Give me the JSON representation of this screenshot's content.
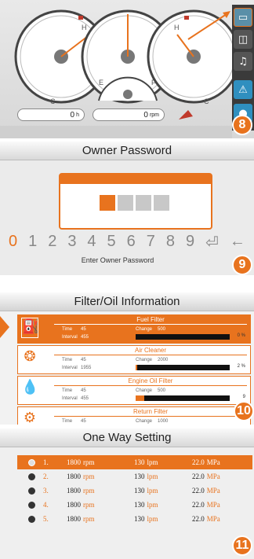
{
  "colors": {
    "accent": "#e8731e",
    "dark": "#3a3a3a",
    "text": "#222222"
  },
  "screen8": {
    "badge": "8",
    "gauge_labels": {
      "left_h": "H",
      "left_c": "C",
      "left_e": "E",
      "right_h": "H",
      "right_c": "C",
      "right_f": "F",
      "small_e": "E",
      "small_f": "F"
    },
    "readout_left": "0",
    "readout_left_unit": "h",
    "readout_right": "0",
    "readout_right_unit": "rpm",
    "side_icons": [
      "monitor-icon",
      "camera-icon",
      "music-icon",
      "warning-icon",
      "info-icon"
    ]
  },
  "screen9": {
    "badge": "9",
    "title": "Owner Password",
    "digits": [
      "0",
      "1",
      "2",
      "3",
      "4",
      "5",
      "6",
      "7",
      "8",
      "9",
      "⏎",
      "←"
    ],
    "hint": "Enter Owner Password"
  },
  "screen10": {
    "badge": "10",
    "title": "Filter/Oil Information",
    "rows": [
      {
        "name": "Fuel Filter",
        "icon": "fuel-filter-icon",
        "glyph": "⛽",
        "time_label": "Time",
        "time_val": "45",
        "interval_label": "Interval",
        "interval_val": "455",
        "change_label": "Change",
        "change_val": "500",
        "progress": 0.0,
        "percent": "0 %"
      },
      {
        "name": "Air Cleaner",
        "icon": "air-cleaner-icon",
        "glyph": "❂",
        "time_label": "Time",
        "time_val": "45",
        "interval_label": "Interval",
        "interval_val": "1955",
        "change_label": "Change",
        "change_val": "2000",
        "progress": 0.02,
        "percent": "2 %"
      },
      {
        "name": "Engine Oil Filter",
        "icon": "engine-oil-icon",
        "glyph": "💧",
        "time_label": "Time",
        "time_val": "45",
        "interval_label": "Interval",
        "interval_val": "455",
        "change_label": "Change",
        "change_val": "500",
        "progress": 0.09,
        "percent": "9"
      },
      {
        "name": "Return Filter",
        "icon": "return-filter-icon",
        "glyph": "⚙",
        "time_label": "Time",
        "time_val": "45",
        "interval_label": "Interval",
        "interval_val": "",
        "change_label": "Change",
        "change_val": "1000",
        "progress": 0.0,
        "percent": ""
      }
    ]
  },
  "screen11": {
    "badge": "11",
    "title": "One Way Setting",
    "rows": [
      {
        "idx": "1.",
        "speed": "1800",
        "speed_unit": "rpm",
        "flow": "130",
        "flow_unit": "lpm",
        "pressure": "22.0",
        "pressure_unit": "MPa",
        "selected": true
      },
      {
        "idx": "2.",
        "speed": "1800",
        "speed_unit": "rpm",
        "flow": "130",
        "flow_unit": "lpm",
        "pressure": "22.0",
        "pressure_unit": "MPa",
        "selected": false
      },
      {
        "idx": "3.",
        "speed": "1800",
        "speed_unit": "rpm",
        "flow": "130",
        "flow_unit": "lpm",
        "pressure": "22.0",
        "pressure_unit": "MPa",
        "selected": false
      },
      {
        "idx": "4.",
        "speed": "1800",
        "speed_unit": "rpm",
        "flow": "130",
        "flow_unit": "lpm",
        "pressure": "22.0",
        "pressure_unit": "MPa",
        "selected": false
      },
      {
        "idx": "5.",
        "speed": "1800",
        "speed_unit": "rpm",
        "flow": "130",
        "flow_unit": "lpm",
        "pressure": "22.0",
        "pressure_unit": "MPa",
        "selected": false
      }
    ]
  }
}
